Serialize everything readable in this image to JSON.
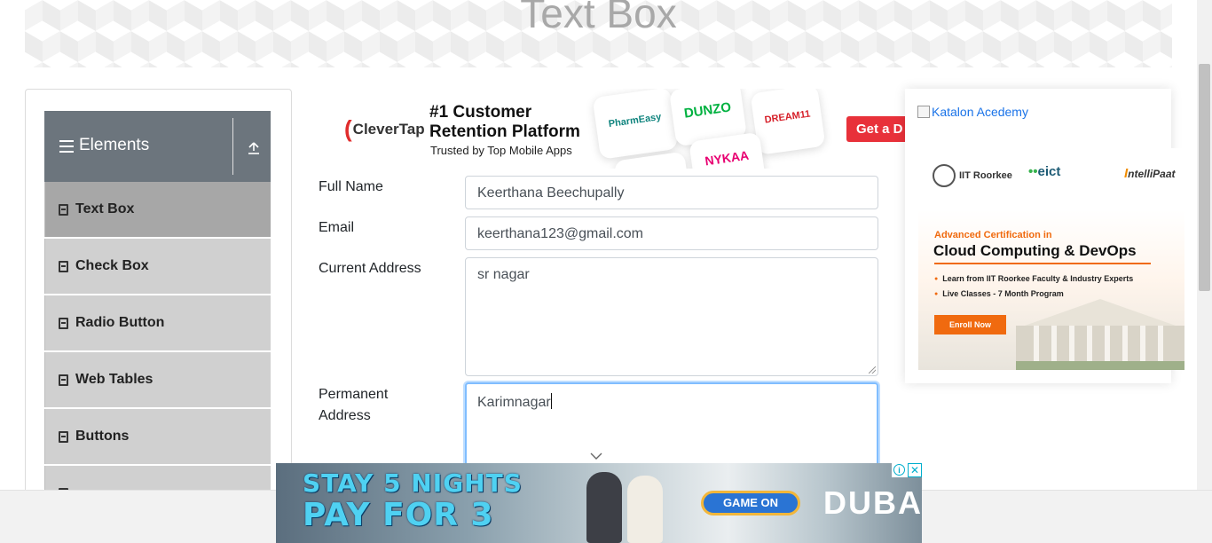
{
  "page": {
    "title": "Text Box"
  },
  "sidebar": {
    "group_label": "Elements",
    "items": [
      {
        "label": "Text Box",
        "active": true
      },
      {
        "label": "Check Box",
        "active": false
      },
      {
        "label": "Radio Button",
        "active": false
      },
      {
        "label": "Web Tables",
        "active": false
      },
      {
        "label": "Buttons",
        "active": false
      }
    ],
    "icons": {
      "menu": "hamburger-icon",
      "collapse": "upload-arrow-icon",
      "item": "html5-icon"
    }
  },
  "top_ad": {
    "brand": "CleverTap",
    "headline": "#1 Customer Retention Platform",
    "subline": "Trusted by Top Mobile Apps",
    "tiles": [
      "PharmEasy",
      "DUNZO",
      "DREAM11",
      "NYKAA"
    ],
    "cta": "Get a D"
  },
  "form": {
    "full_name": {
      "label": "Full Name",
      "value": "Keerthana Beechupally"
    },
    "email": {
      "label": "Email",
      "value": "keerthana123@gmail.com"
    },
    "current_address": {
      "label": "Current Address",
      "value": "sr nagar"
    },
    "permanent_address": {
      "label_line1": "Permanent",
      "label_line2": "Address",
      "value": "Karimnagar"
    }
  },
  "right_ad": {
    "broken_image_alt": "Katalon Acedemy",
    "partner1": "IIT Roorkee",
    "partner2": "eict",
    "partner3": "ntelliPaat",
    "kicker": "Advanced Certification in",
    "title": "Cloud Computing & DevOps",
    "bullets": [
      "Learn from IIT Roorkee Faculty & Industry Experts",
      "Live Classes - 7 Month Program"
    ],
    "cta": "Enroll Now"
  },
  "bottom_ad": {
    "line1": "STAY 5 NIGHTS",
    "line2": "PAY FOR 3",
    "cta": "GAME ON",
    "brand": "DUBAI",
    "info_glyph": "i",
    "close_glyph": "✕"
  },
  "colors": {
    "sidebar_header": "#6c757d",
    "menu_item": "#d0d0d0",
    "menu_item_active": "#a7a7a7",
    "focus_border": "#80bdff",
    "link": "#1a73e8",
    "clevertap_red": "#e8313a",
    "intellipaat_orange": "#f06a0f"
  }
}
